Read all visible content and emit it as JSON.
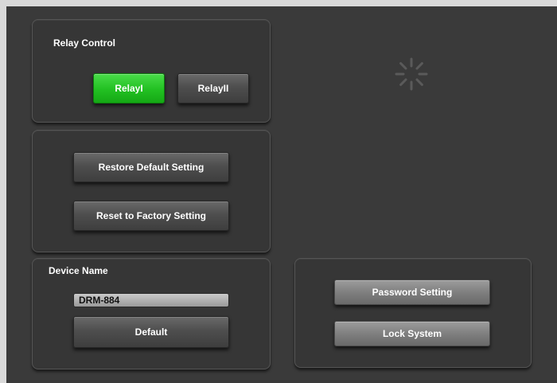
{
  "relay_panel": {
    "title": "Relay Control",
    "relay1_label": "RelayI",
    "relay2_label": "RelayII",
    "active_relay": "RelayI"
  },
  "settings_panel": {
    "restore_label": "Restore Default Setting",
    "reset_label": "Reset to Factory Setting"
  },
  "device_panel": {
    "title": "Device Name",
    "name_value": "DRM-884",
    "default_label": "Default"
  },
  "security_panel": {
    "password_label": "Password Setting",
    "lock_label": "Lock System"
  },
  "loading_indicator": {
    "icon": "loading-spinner-icon"
  },
  "colors": {
    "background": "#3a3a3a",
    "panel": "#363636",
    "active_button": "#22c022",
    "dark_button": "#4e4e4e",
    "light_button": "#7d7d7d"
  }
}
